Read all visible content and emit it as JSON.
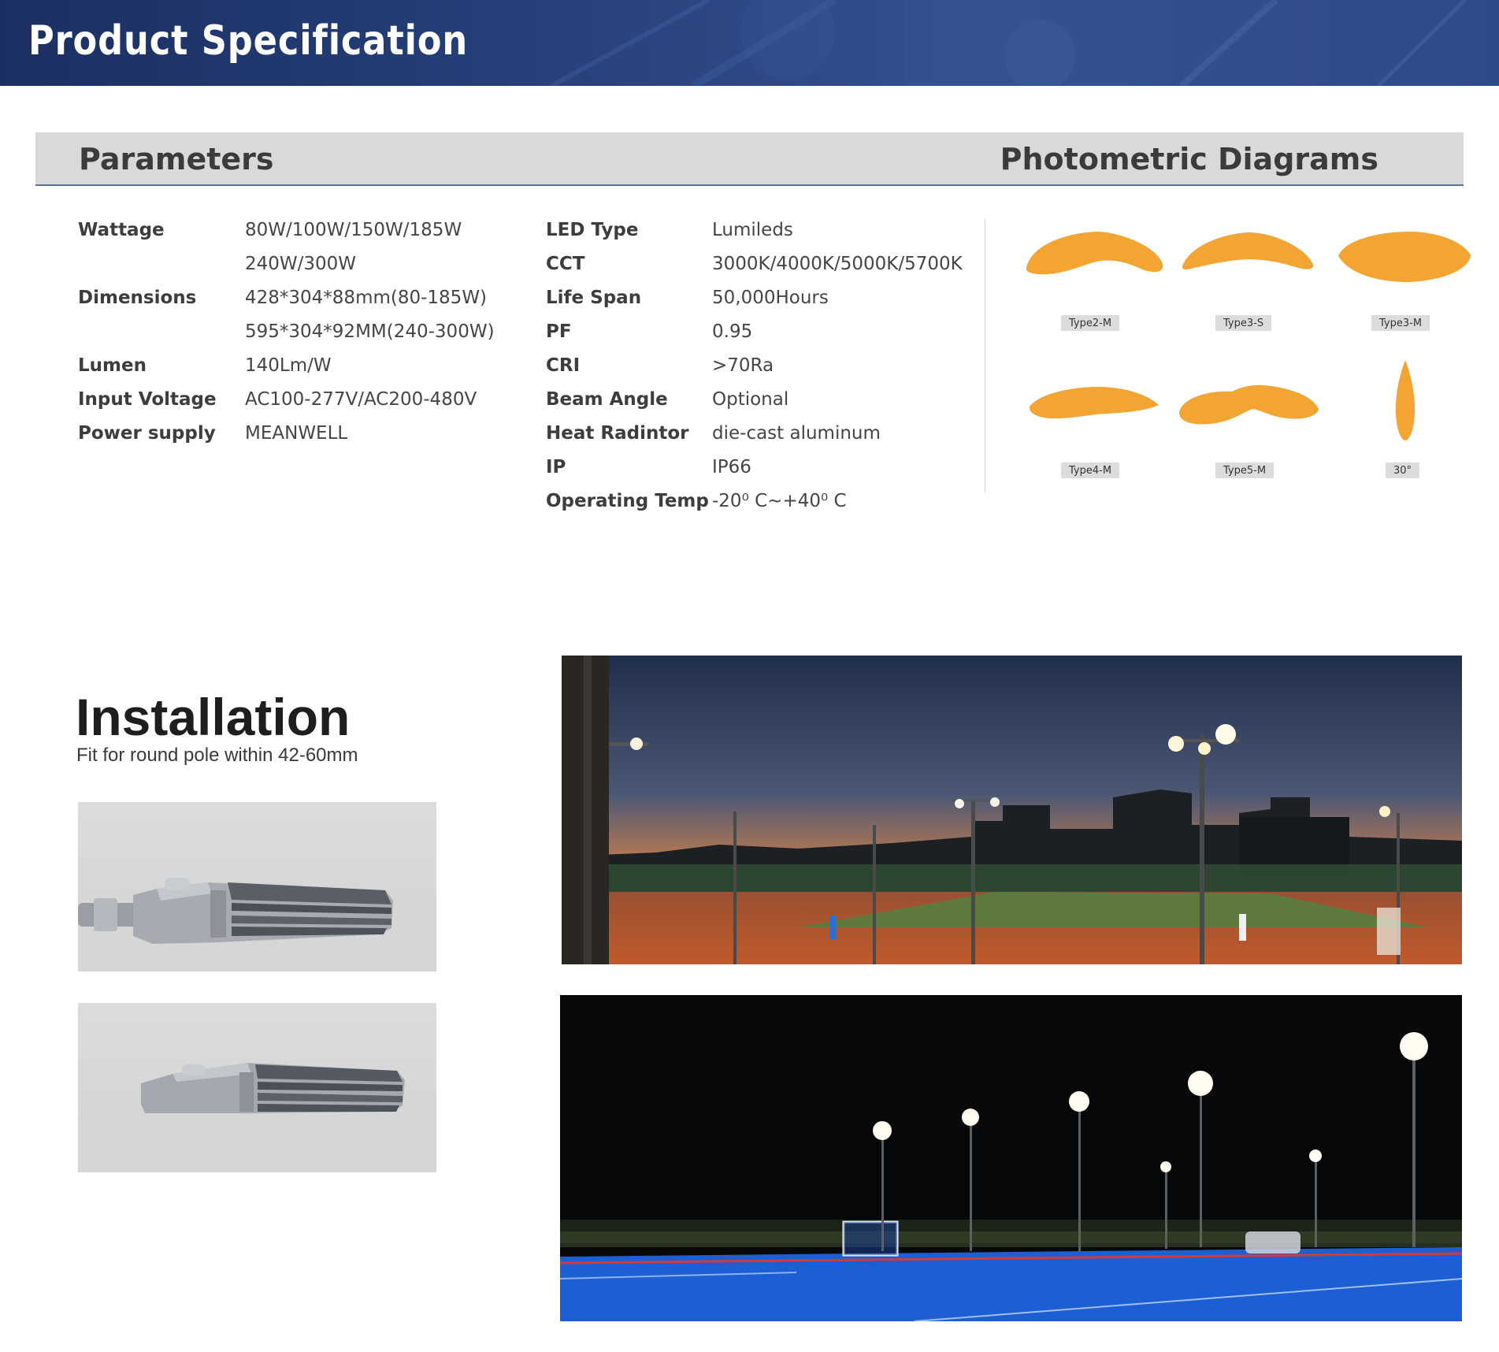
{
  "header": {
    "title": "Product Specification"
  },
  "sections": {
    "parameters_title": "Parameters",
    "photometric_title": "Photometric Diagrams"
  },
  "parameters": {
    "left": [
      {
        "label": "Wattage",
        "value": "80W/100W/150W/185W"
      },
      {
        "label": "",
        "value": "240W/300W"
      },
      {
        "label": "Dimensions",
        "value": "428*304*88mm(80-185W)"
      },
      {
        "label": "",
        "value": "595*304*92MM(240-300W)"
      },
      {
        "label": "Lumen",
        "value": "140Lm/W"
      },
      {
        "label": "Input Voltage",
        "value": "AC100-277V/AC200-480V"
      },
      {
        "label": "Power supply",
        "value": "MEANWELL"
      }
    ],
    "right": [
      {
        "label": "LED Type",
        "value": "Lumileds"
      },
      {
        "label": "CCT",
        "value": "3000K/4000K/5000K/5700K"
      },
      {
        "label": "Life Span",
        "value": "50,000Hours"
      },
      {
        "label": "PF",
        "value": "0.95"
      },
      {
        "label": "CRI",
        "value": ">70Ra"
      },
      {
        "label": "Beam Angle",
        "value": "Optional"
      },
      {
        "label": "Heat Radintor",
        "value": "die-cast aluminum"
      },
      {
        "label": "IP",
        "value": "IP66"
      },
      {
        "label": "Operating  Temp",
        "value": "-20⁰ C~+40⁰ C"
      }
    ]
  },
  "diagrams": [
    {
      "label": "Type2-M"
    },
    {
      "label": "Type3-S"
    },
    {
      "label": "Type3-M"
    },
    {
      "label": "Type4-M"
    },
    {
      "label": "Type5-M"
    },
    {
      "label": "30°"
    }
  ],
  "colors": {
    "diagram_fill": "#f2a533",
    "banner": "#26407a",
    "section_bar": "#d9d9db"
  },
  "installation": {
    "title": "Installation",
    "subtitle": "Fit for round pole within 42-60mm"
  }
}
